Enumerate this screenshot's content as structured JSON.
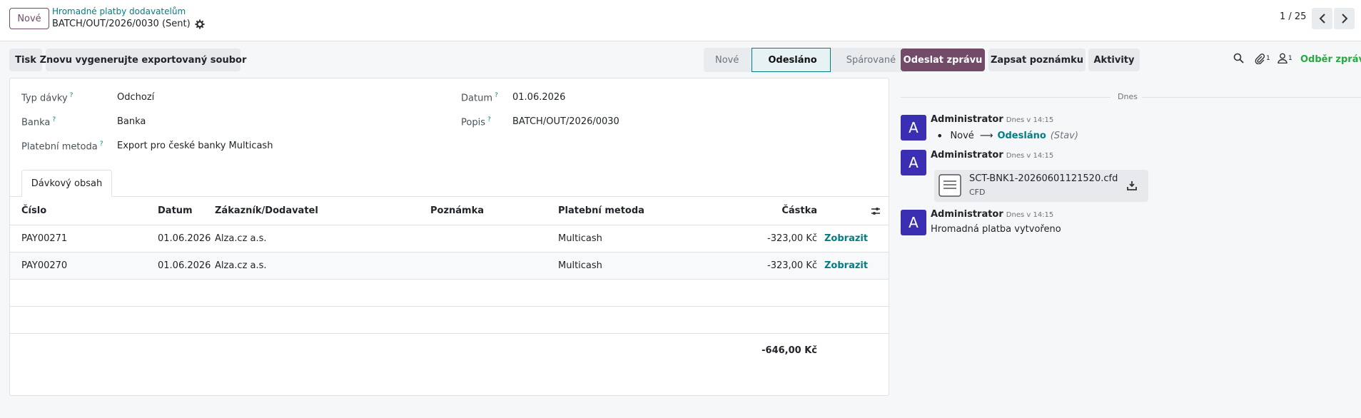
{
  "header": {
    "new_button": "Nové",
    "breadcrumb": "Hromadné platby dodavatelům",
    "record_name": "BATCH/OUT/2026/0030 (Sent)",
    "pager": "1 / 25"
  },
  "actions": {
    "print": "Tisk",
    "regenerate": "Znovu vygenerujte exportovaný soubor"
  },
  "stages": [
    "Nové",
    "Odesláno",
    "Spárované"
  ],
  "form": {
    "type_label": "Typ dávky",
    "type_value": "Odchozí",
    "bank_label": "Banka",
    "bank_value": "Banka",
    "method_label": "Platební metoda",
    "method_value": "Export pro české banky Multicash",
    "date_label": "Datum",
    "date_value": "01.06.2026",
    "desc_label": "Popis",
    "desc_value": "BATCH/OUT/2026/0030",
    "help_mark": "?"
  },
  "tab": {
    "label": "Dávkový obsah"
  },
  "table": {
    "headers": {
      "number": "Číslo",
      "date": "Datum",
      "partner": "Zákazník/Dodavatel",
      "memo": "Poznámka",
      "method": "Platební metoda",
      "amount": "Částka"
    },
    "rows": [
      {
        "number": "PAY00271",
        "date": "01.06.2026",
        "partner": "Alza.cz a.s.",
        "memo": "",
        "method": "Multicash",
        "amount": "-323,00 Kč",
        "action": "Zobrazit"
      },
      {
        "number": "PAY00270",
        "date": "01.06.2026",
        "partner": "Alza.cz a.s.",
        "memo": "",
        "method": "Multicash",
        "amount": "-323,00 Kč",
        "action": "Zobrazit"
      }
    ],
    "total": "-646,00 Kč"
  },
  "chatter": {
    "send_message": "Odeslat zprávu",
    "log_note": "Zapsat poznámku",
    "activities": "Aktivity",
    "attachments_count": "1",
    "followers_count": "1",
    "follow": "Odběr zpráv",
    "date_divider": "Dnes",
    "messages": [
      {
        "avatar": "A",
        "author": "Administrator",
        "time": "Dnes v 14:15",
        "from": "Nové",
        "to": "Odesláno",
        "field": "(Stav)"
      },
      {
        "avatar": "A",
        "author": "Administrator",
        "time": "Dnes v 14:15",
        "file_name": "SCT-BNK1-20260601121520.cfd",
        "file_ext": "CFD"
      },
      {
        "avatar": "A",
        "author": "Administrator",
        "time": "Dnes v 14:15",
        "text": "Hromadná platba vytvořeno"
      }
    ]
  },
  "colors": {
    "primary": "#714b67",
    "link": "#017e84",
    "avatar": "#3a2fb3",
    "follow": "#28a745"
  }
}
